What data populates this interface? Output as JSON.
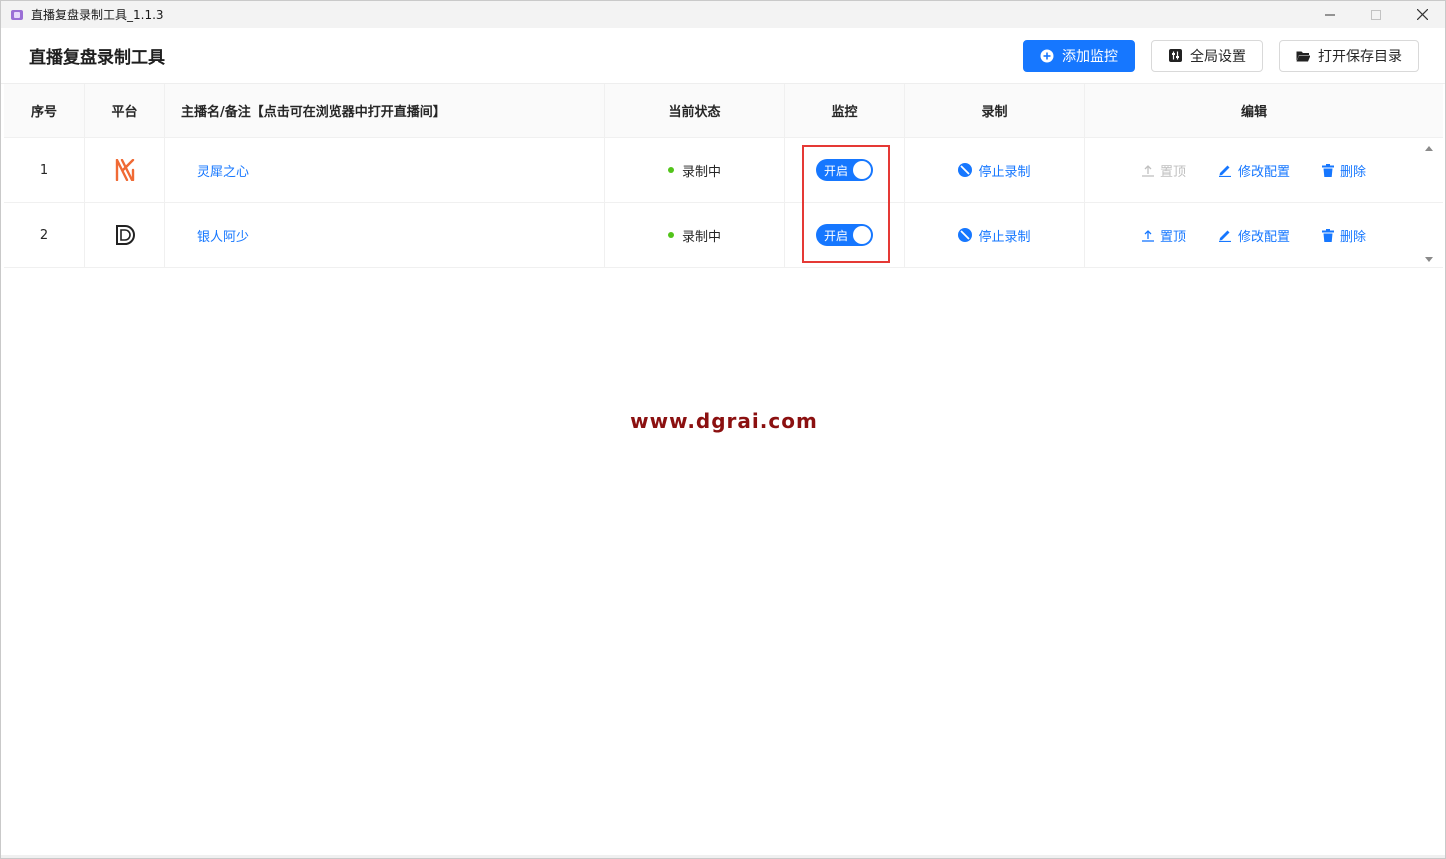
{
  "window": {
    "title": "直播复盘录制工具_1.1.3",
    "controls": {
      "minimize": "minimize-icon",
      "maximize": "maximize-icon",
      "close": "close-icon"
    }
  },
  "header": {
    "title": "直播复盘录制工具",
    "buttons": {
      "add_monitor": "添加监控",
      "global_settings": "全局设置",
      "open_save_dir": "打开保存目录"
    }
  },
  "table": {
    "columns": [
      "序号",
      "平台",
      "主播名/备注【点击可在浏览器中打开直播间】",
      "当前状态",
      "监控",
      "录制",
      "编辑"
    ],
    "rows": [
      {
        "index": "1",
        "platform_icon": "kuaishou-logo-icon",
        "name": "灵犀之心",
        "status": "录制中",
        "monitor_label": "开启",
        "monitor_on": true,
        "record_action": "停止录制",
        "pin_label": "置顶",
        "pin_enabled": false,
        "edit_label": "修改配置",
        "delete_label": "删除"
      },
      {
        "index": "2",
        "platform_icon": "douyin-logo-icon",
        "name": "银人阿少",
        "status": "录制中",
        "monitor_label": "开启",
        "monitor_on": true,
        "record_action": "停止录制",
        "pin_label": "置顶",
        "pin_enabled": true,
        "edit_label": "修改配置",
        "delete_label": "删除"
      }
    ]
  },
  "watermark": "www.dgrai.com",
  "colors": {
    "primary": "#1677ff",
    "status_dot": "#52c41a",
    "highlight": "#e53935",
    "watermark": "#8b1010"
  }
}
